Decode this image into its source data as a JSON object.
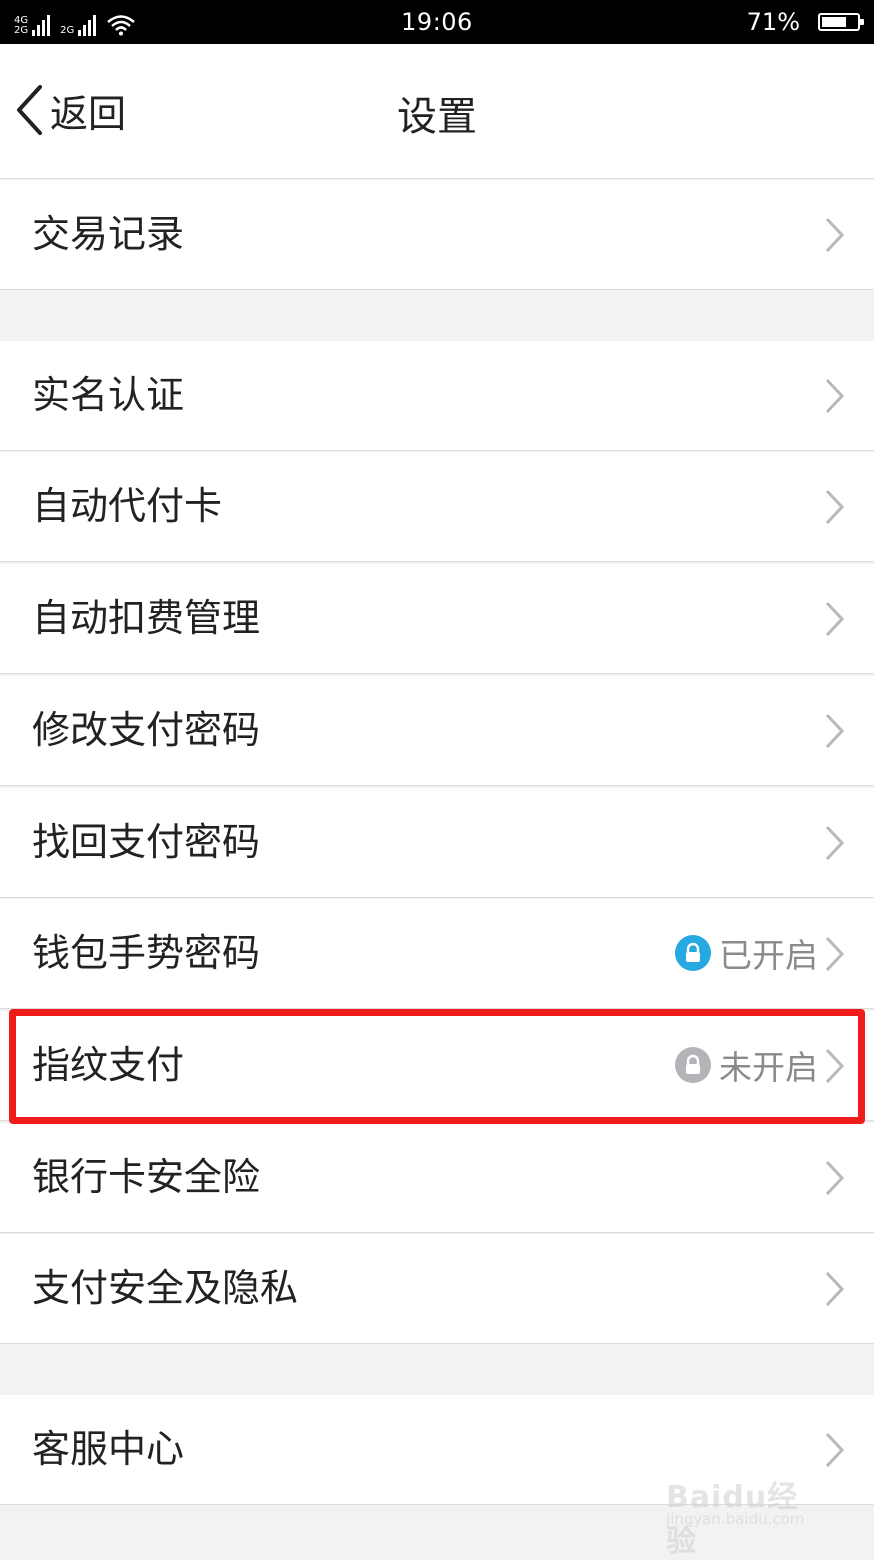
{
  "status_bar": {
    "net1": "4G",
    "net1b": "2G",
    "net2": "2G",
    "time": "19:06",
    "battery_percent": "71%",
    "battery_level": 0.71
  },
  "nav": {
    "back_label": "返回",
    "title": "设置"
  },
  "items": [
    {
      "label": "交易记录"
    },
    {
      "label": "实名认证"
    },
    {
      "label": "自动代付卡"
    },
    {
      "label": "自动扣费管理"
    },
    {
      "label": "修改支付密码"
    },
    {
      "label": "找回支付密码"
    },
    {
      "label": "钱包手势密码",
      "status": "已开启",
      "status_color": "#26a8e0"
    },
    {
      "label": "指纹支付",
      "status": "未开启",
      "status_color": "#b4b4b8"
    },
    {
      "label": "银行卡安全险"
    },
    {
      "label": "支付安全及隐私"
    },
    {
      "label": "客服中心"
    }
  ],
  "colors": {
    "highlight": "#f01c1c",
    "enabled_lock": "#26a8e0",
    "disabled_lock": "#b4b4b8"
  },
  "watermark": {
    "text": "Baidu经验",
    "sub": "jingyan.baidu.com"
  }
}
